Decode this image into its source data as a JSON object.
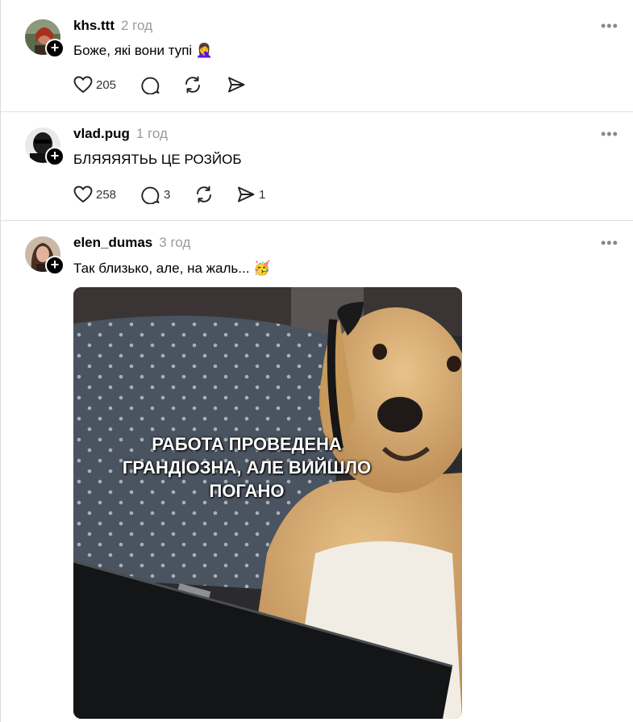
{
  "posts": [
    {
      "username": "khs.ttt",
      "time": "2 год",
      "text": "Боже, які вони тупі 🤦‍♀️",
      "likes": "205",
      "comments": "",
      "reposts": "",
      "shares": ""
    },
    {
      "username": "vlad.pug",
      "time": "1 год",
      "text": "БЛЯЯЯЯТЬЬ ЦЕ РОЗЙОБ",
      "likes": "258",
      "comments": "3",
      "reposts": "",
      "shares": "1"
    },
    {
      "username": "elen_dumas",
      "time": "3 год",
      "text": "Так близько, але, на жаль... 🥳",
      "likes": "",
      "comments": "",
      "reposts": "",
      "shares": ""
    }
  ],
  "more_label": "•••",
  "meme": {
    "caption_line1": "РАБОТА ПРОВЕДЕНА",
    "caption_line2": "ГРАНДІОЗНА, АЛЕ ВИЙШЛО",
    "caption_line3": "ПОГАНО"
  },
  "icons": {
    "like": "heart-icon",
    "comment": "comment-icon",
    "repost": "repost-icon",
    "share": "share-icon"
  }
}
